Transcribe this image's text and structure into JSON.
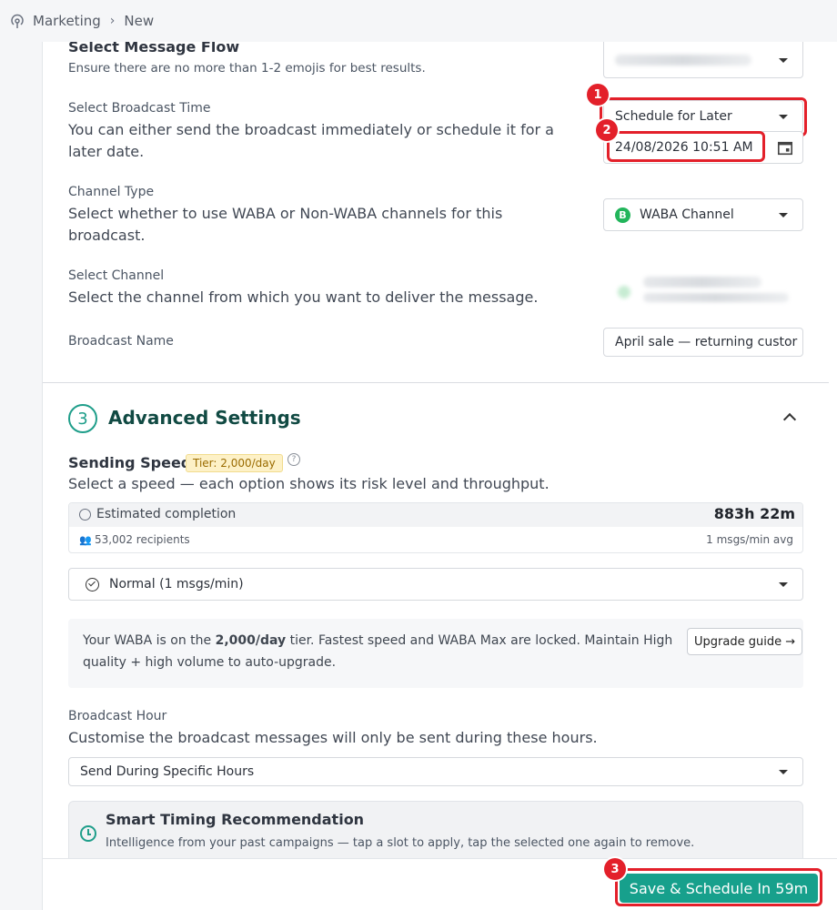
{
  "breadcrumb": {
    "root": "Marketing",
    "current": "New"
  },
  "message_flow": {
    "title": "Select Message Flow",
    "hint": "Ensure there are no more than 1-2 emojis for best results."
  },
  "broadcast_time": {
    "label": "Select Broadcast Time",
    "description": "You can either send the broadcast immediately or schedule it for a later date.",
    "selected": "Schedule for Later",
    "datetime": "24/08/2026 10:51 AM"
  },
  "channel_type": {
    "label": "Channel Type",
    "description": "Select whether to use WABA or Non-WABA channels for this broadcast.",
    "selected": "WABA Channel",
    "badge_letter": "B"
  },
  "channel": {
    "label": "Select Channel",
    "description": "Select the channel from which you want to deliver the message."
  },
  "broadcast_name": {
    "label": "Broadcast Name",
    "value": "April sale — returning custor"
  },
  "advanced": {
    "step": "3",
    "title": "Advanced Settings",
    "sending_speed": {
      "label": "Sending Speed",
      "tier_badge": "Tier: 2,000/day",
      "help_glyph": "?",
      "description": "Select a speed — each option shows its risk level and throughput."
    },
    "estimate": {
      "label": "Estimated completion",
      "value": "883h 22m",
      "recipients": "53,002 recipients",
      "rate": "1 msgs/min avg"
    },
    "speed_select": "Normal (1 msgs/min)",
    "info": {
      "text_before": "Your WABA is on the ",
      "text_bold": "2,000/day",
      "text_after": " tier. Fastest speed and WABA Max are locked. Maintain High quality + high volume to auto-upgrade.",
      "button": "Upgrade guide →"
    },
    "broadcast_hour": {
      "label": "Broadcast Hour",
      "description": "Customise the broadcast messages will only be sent during these hours.",
      "selected": "Send During Specific Hours"
    },
    "smart_timing": {
      "title": "Smart Timing Recommendation",
      "description": "Intelligence from your past campaigns — tap a slot to apply, tap the selected one again to remove."
    }
  },
  "save_button": "Save & Schedule In 59m",
  "annotations": [
    "1",
    "2",
    "3"
  ],
  "colors": {
    "accent": "#17a08c",
    "highlight": "#e3202a",
    "tier_bg": "#fdf1c7"
  }
}
